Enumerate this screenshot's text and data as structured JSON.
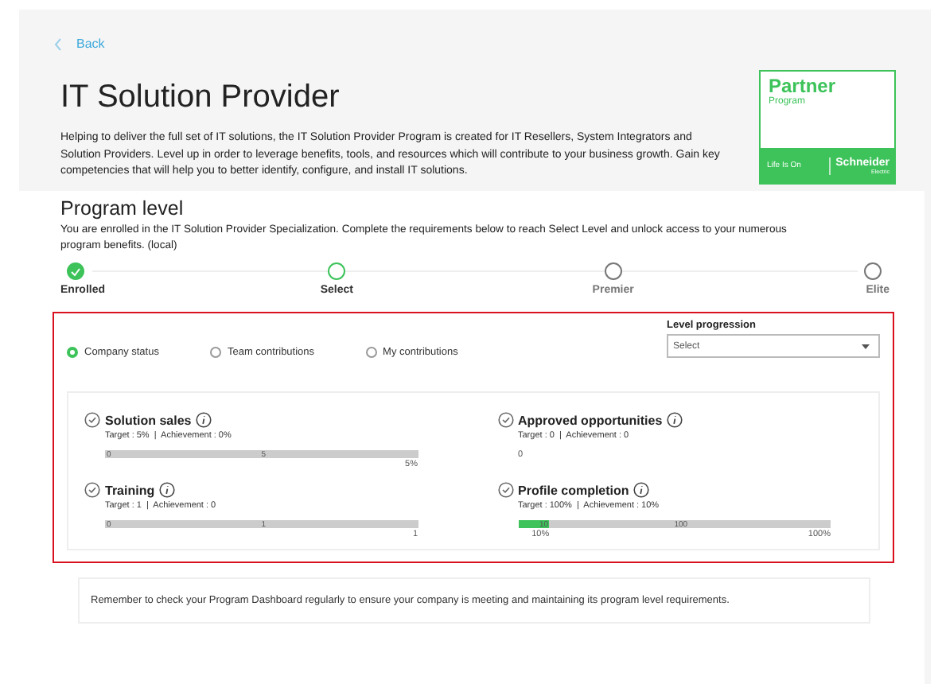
{
  "back": {
    "label": "Back"
  },
  "header": {
    "title": "IT Solution Provider",
    "description": "Helping to deliver the full set of IT solutions, the IT Solution Provider Program is created for IT Resellers, System Integrators and Solution Providers. Level up in order to leverage benefits, tools, and resources which will contribute to your business growth. Gain key competencies that will help you to better identify, configure, and install IT solutions."
  },
  "logo": {
    "title": "Partner",
    "subtitle": "Program",
    "tagline": "Life Is On",
    "brand": "Schneider",
    "brand_sub": "Electric"
  },
  "program_level": {
    "title": "Program level",
    "description": "You are enrolled in the IT Solution Provider Specialization. Complete the requirements below to reach Select Level and unlock access to your numerous program benefits. (local)",
    "steps": [
      {
        "label": "Enrolled",
        "completed": true,
        "current": false
      },
      {
        "label": "Select",
        "completed": false,
        "current": true
      },
      {
        "label": "Premier",
        "completed": false,
        "current": false
      },
      {
        "label": "Elite",
        "completed": false,
        "current": false
      }
    ]
  },
  "views": [
    {
      "label": "Company status",
      "selected": true
    },
    {
      "label": "Team contributions",
      "selected": false
    },
    {
      "label": "My contributions",
      "selected": false
    }
  ],
  "level_progression": {
    "label": "Level progression",
    "placeholder": "Select"
  },
  "metrics": [
    {
      "kind": "bar",
      "name": "Solution sales",
      "summary": "Target : 5%  |  Achievement : 0%",
      "start_label": "0",
      "mid_label": "5",
      "level": 0,
      "end_reading": "5%"
    },
    {
      "kind": "value",
      "name": "Approved opportunities",
      "summary": "Target : 0  |  Achievement : 0",
      "value": "0"
    },
    {
      "kind": "bar",
      "name": "Training",
      "summary": "Target : 1  |  Achievement : 0",
      "start_label": "0",
      "mid_label": "1",
      "level": 0,
      "end_reading": "1"
    },
    {
      "kind": "bar",
      "name": "Profile completion",
      "summary": "Target : 100%  |  Achievement : 10%",
      "fill_label": "10",
      "mid_label": "100",
      "level": 0.1,
      "fill_reading": "10%",
      "end_reading": "100%"
    }
  ],
  "note": "Remember to check your Program Dashboard regularly to ensure your company is meeting and maintaining its program level requirements."
}
